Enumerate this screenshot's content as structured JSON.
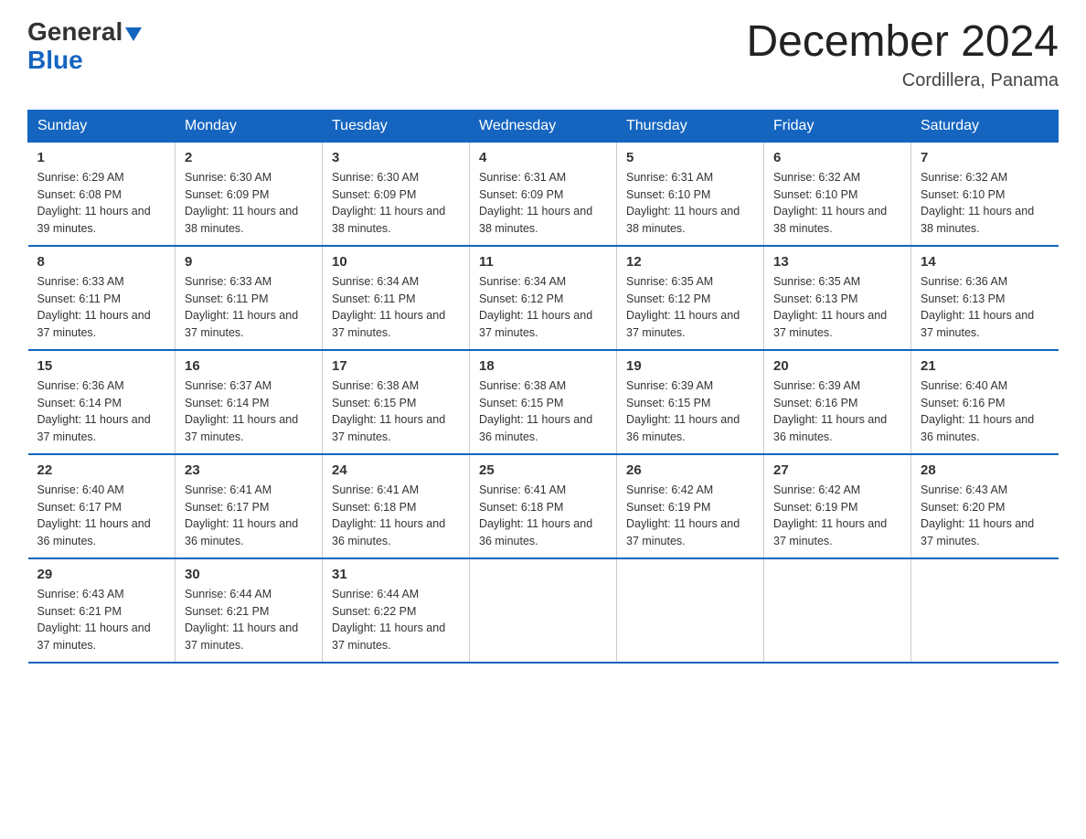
{
  "header": {
    "logo_general": "General",
    "logo_blue": "Blue",
    "title": "December 2024",
    "subtitle": "Cordillera, Panama"
  },
  "days_of_week": [
    "Sunday",
    "Monday",
    "Tuesday",
    "Wednesday",
    "Thursday",
    "Friday",
    "Saturday"
  ],
  "weeks": [
    [
      {
        "day": "1",
        "sunrise": "6:29 AM",
        "sunset": "6:08 PM",
        "daylight": "11 hours and 39 minutes."
      },
      {
        "day": "2",
        "sunrise": "6:30 AM",
        "sunset": "6:09 PM",
        "daylight": "11 hours and 38 minutes."
      },
      {
        "day": "3",
        "sunrise": "6:30 AM",
        "sunset": "6:09 PM",
        "daylight": "11 hours and 38 minutes."
      },
      {
        "day": "4",
        "sunrise": "6:31 AM",
        "sunset": "6:09 PM",
        "daylight": "11 hours and 38 minutes."
      },
      {
        "day": "5",
        "sunrise": "6:31 AM",
        "sunset": "6:10 PM",
        "daylight": "11 hours and 38 minutes."
      },
      {
        "day": "6",
        "sunrise": "6:32 AM",
        "sunset": "6:10 PM",
        "daylight": "11 hours and 38 minutes."
      },
      {
        "day": "7",
        "sunrise": "6:32 AM",
        "sunset": "6:10 PM",
        "daylight": "11 hours and 38 minutes."
      }
    ],
    [
      {
        "day": "8",
        "sunrise": "6:33 AM",
        "sunset": "6:11 PM",
        "daylight": "11 hours and 37 minutes."
      },
      {
        "day": "9",
        "sunrise": "6:33 AM",
        "sunset": "6:11 PM",
        "daylight": "11 hours and 37 minutes."
      },
      {
        "day": "10",
        "sunrise": "6:34 AM",
        "sunset": "6:11 PM",
        "daylight": "11 hours and 37 minutes."
      },
      {
        "day": "11",
        "sunrise": "6:34 AM",
        "sunset": "6:12 PM",
        "daylight": "11 hours and 37 minutes."
      },
      {
        "day": "12",
        "sunrise": "6:35 AM",
        "sunset": "6:12 PM",
        "daylight": "11 hours and 37 minutes."
      },
      {
        "day": "13",
        "sunrise": "6:35 AM",
        "sunset": "6:13 PM",
        "daylight": "11 hours and 37 minutes."
      },
      {
        "day": "14",
        "sunrise": "6:36 AM",
        "sunset": "6:13 PM",
        "daylight": "11 hours and 37 minutes."
      }
    ],
    [
      {
        "day": "15",
        "sunrise": "6:36 AM",
        "sunset": "6:14 PM",
        "daylight": "11 hours and 37 minutes."
      },
      {
        "day": "16",
        "sunrise": "6:37 AM",
        "sunset": "6:14 PM",
        "daylight": "11 hours and 37 minutes."
      },
      {
        "day": "17",
        "sunrise": "6:38 AM",
        "sunset": "6:15 PM",
        "daylight": "11 hours and 37 minutes."
      },
      {
        "day": "18",
        "sunrise": "6:38 AM",
        "sunset": "6:15 PM",
        "daylight": "11 hours and 36 minutes."
      },
      {
        "day": "19",
        "sunrise": "6:39 AM",
        "sunset": "6:15 PM",
        "daylight": "11 hours and 36 minutes."
      },
      {
        "day": "20",
        "sunrise": "6:39 AM",
        "sunset": "6:16 PM",
        "daylight": "11 hours and 36 minutes."
      },
      {
        "day": "21",
        "sunrise": "6:40 AM",
        "sunset": "6:16 PM",
        "daylight": "11 hours and 36 minutes."
      }
    ],
    [
      {
        "day": "22",
        "sunrise": "6:40 AM",
        "sunset": "6:17 PM",
        "daylight": "11 hours and 36 minutes."
      },
      {
        "day": "23",
        "sunrise": "6:41 AM",
        "sunset": "6:17 PM",
        "daylight": "11 hours and 36 minutes."
      },
      {
        "day": "24",
        "sunrise": "6:41 AM",
        "sunset": "6:18 PM",
        "daylight": "11 hours and 36 minutes."
      },
      {
        "day": "25",
        "sunrise": "6:41 AM",
        "sunset": "6:18 PM",
        "daylight": "11 hours and 36 minutes."
      },
      {
        "day": "26",
        "sunrise": "6:42 AM",
        "sunset": "6:19 PM",
        "daylight": "11 hours and 37 minutes."
      },
      {
        "day": "27",
        "sunrise": "6:42 AM",
        "sunset": "6:19 PM",
        "daylight": "11 hours and 37 minutes."
      },
      {
        "day": "28",
        "sunrise": "6:43 AM",
        "sunset": "6:20 PM",
        "daylight": "11 hours and 37 minutes."
      }
    ],
    [
      {
        "day": "29",
        "sunrise": "6:43 AM",
        "sunset": "6:21 PM",
        "daylight": "11 hours and 37 minutes."
      },
      {
        "day": "30",
        "sunrise": "6:44 AM",
        "sunset": "6:21 PM",
        "daylight": "11 hours and 37 minutes."
      },
      {
        "day": "31",
        "sunrise": "6:44 AM",
        "sunset": "6:22 PM",
        "daylight": "11 hours and 37 minutes."
      },
      null,
      null,
      null,
      null
    ]
  ],
  "labels": {
    "sunrise": "Sunrise:",
    "sunset": "Sunset:",
    "daylight": "Daylight:"
  }
}
